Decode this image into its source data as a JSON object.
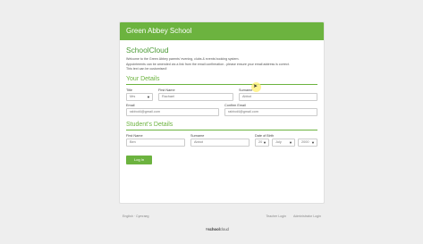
{
  "header": {
    "school_name": "Green Abbey School"
  },
  "app": {
    "title": "SchoolCloud",
    "intro": [
      "Welcome to the Green Abbey parents' evening, clubs & events booking system.",
      "Appointments can be amended via a link from the email confirmation - please ensure your email address is correct.",
      "This text can be customised!"
    ]
  },
  "your_details": {
    "heading": "Your Details",
    "title_label": "Title",
    "title_value": "Mrs",
    "first_name_label": "First Name",
    "first_name_value": "Rachael",
    "surname_label": "Surname",
    "surname_value": "Abbot",
    "email_label": "Email",
    "email_value": "rabbot4@gmail.com",
    "confirm_email_label": "Confirm Email",
    "confirm_email_value": "rabbot4@gmail.com"
  },
  "student_details": {
    "heading": "Student's Details",
    "first_name_label": "First Name",
    "first_name_value": "Ben",
    "surname_label": "Surname",
    "surname_value": "Abbot",
    "dob_label": "Date of Birth",
    "dob_day": "20",
    "dob_month": "July",
    "dob_year": "2000"
  },
  "actions": {
    "login_label": "Log In"
  },
  "footer": {
    "languages": "English · Cymraeg",
    "teacher_login": "Teacher Login",
    "admin_login": "Administrator Login",
    "brand_prefix": "#",
    "brand_bold": "school",
    "brand_suffix": "cloud"
  },
  "icons": {
    "select_chevron": "chevron-down-icon",
    "cursor": "pointer-cursor-icon"
  },
  "colors": {
    "accent": "#6cb33f",
    "background": "#eeeeee"
  }
}
